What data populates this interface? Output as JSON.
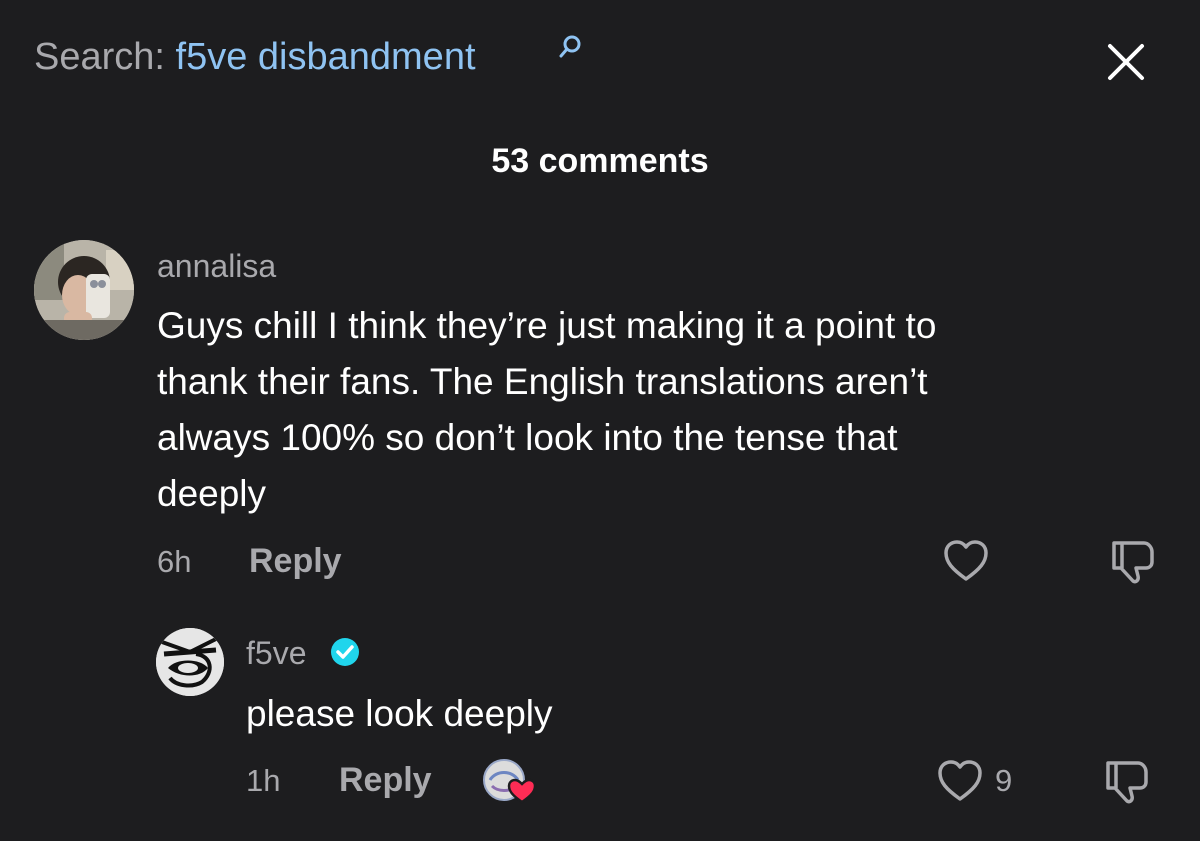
{
  "header": {
    "search_prefix": "Search: ",
    "search_query": "f5ve disbandment",
    "comment_count": "53 comments"
  },
  "comment": {
    "username": "annalisa",
    "text_lines": [
      "Guys chill I think they’re just making it a point to",
      "thank their fans. The English translations aren’t",
      "always 100% so don’t look into the tense that",
      "deeply"
    ],
    "time": "6h",
    "reply_label": "Reply"
  },
  "reply": {
    "username": "f5ve",
    "text": "please look deeply",
    "time": "1h",
    "reply_label": "Reply",
    "like_count": "9"
  },
  "colors": {
    "background": "#1d1d1f",
    "muted_text": "#a9a9ad",
    "search_query": "#8fc3f2",
    "verified_badge": "#20d5ec",
    "heart_red": "#fe2c55"
  }
}
